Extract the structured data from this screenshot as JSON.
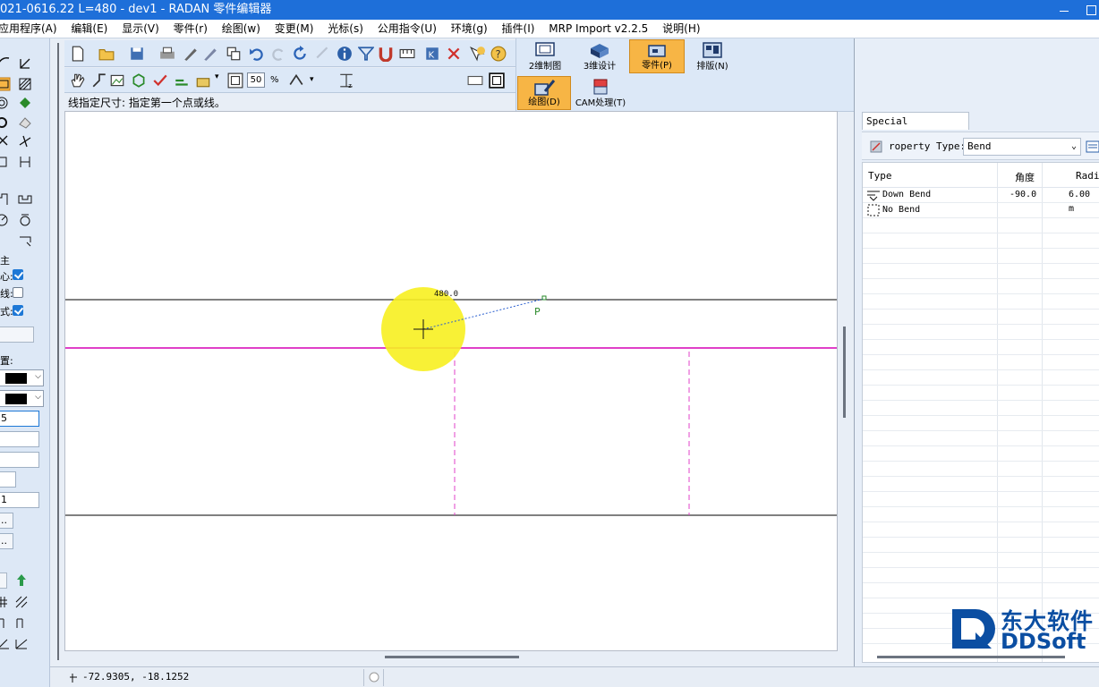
{
  "window": {
    "title": "021-0616.22 L=480 - dev1 - RADAN 零件编辑器"
  },
  "menu": [
    "应用程序(A)",
    "编辑(E)",
    "显示(V)",
    "零件(r)",
    "绘图(w)",
    "变更(M)",
    "光标(s)",
    "公用指令(U)",
    "环境(g)",
    "插件(I)",
    "MRP Import v2.2.5",
    "说明(H)"
  ],
  "left_panel": {
    "lbl_1": "主",
    "lbl_2": "心:",
    "lbl_3": "线:",
    "lbl_4": "式:",
    "lbl_settings": "置:",
    "field_1": "5",
    "field_2": "1",
    "btn_1": "..",
    "btn_2": ".."
  },
  "toolbar": {
    "zoom_value": "50",
    "zoom_unit": "%",
    "hint": "线指定尺寸: 指定第一个点或线。"
  },
  "modes": {
    "drawing_2d": "2维制图",
    "design_3d": "3维设计",
    "part": "零件(P)",
    "nesting": "排版(N)",
    "draw": "绘图(D)",
    "cam": "CAM处理(T)"
  },
  "canvas": {
    "dimension_label": "480.0",
    "point_label": "P",
    "colors": {
      "line": "#000000",
      "bend_line": "#e040c8",
      "highlight": "#f7ef20",
      "guide": "#2a5fd0",
      "point": "#2a8a2a"
    }
  },
  "properties": {
    "tab_label": "Special Properties",
    "type_label": "roperty Type:",
    "type_value": "Bend",
    "columns": [
      "Type",
      "角度",
      "Radiu"
    ],
    "rows": [
      {
        "type": "Down Bend",
        "angle": "-90.0",
        "radius": "6.00 m"
      },
      {
        "type": "No Bend",
        "angle": "",
        "radius": ""
      }
    ]
  },
  "status": {
    "coordinates": "-72.9305,  -18.1252"
  },
  "logo": {
    "cn": "东大软件",
    "en": "DDSoft"
  }
}
